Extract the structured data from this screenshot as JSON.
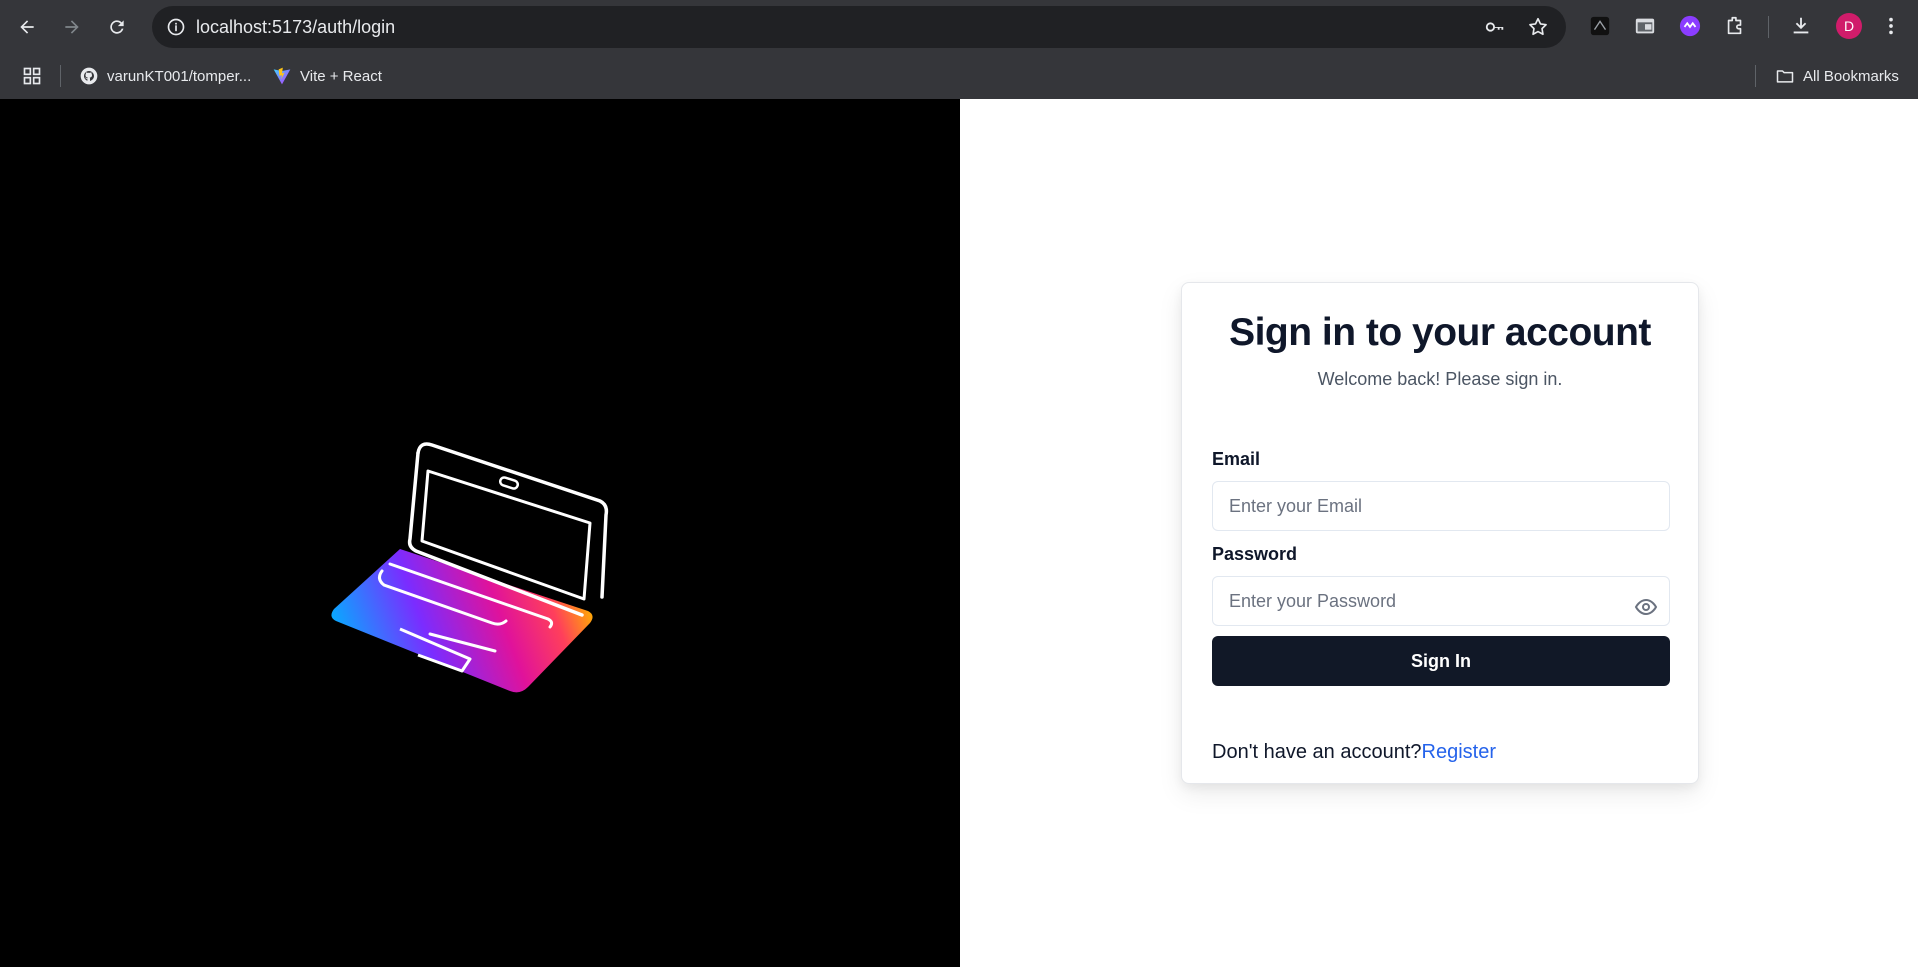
{
  "browser": {
    "url": "localhost:5173/auth/login",
    "profile_initial": "D",
    "bookmarks": [
      {
        "label": "varunKT001/tomper...",
        "icon": "github-icon"
      },
      {
        "label": "Vite + React",
        "icon": "vite-icon"
      }
    ],
    "all_bookmarks_label": "All Bookmarks"
  },
  "login": {
    "title": "Sign in to your account",
    "subtitle": "Welcome back! Please sign in.",
    "email_label": "Email",
    "email_placeholder": "Enter your Email",
    "password_label": "Password",
    "password_placeholder": "Enter your Password",
    "submit_label": "Sign In",
    "no_account_text": "Don't have an account?",
    "register_label": "Register"
  },
  "colors": {
    "left_panel_bg": "#000000",
    "primary_button": "#111827",
    "link": "#2563eb"
  }
}
